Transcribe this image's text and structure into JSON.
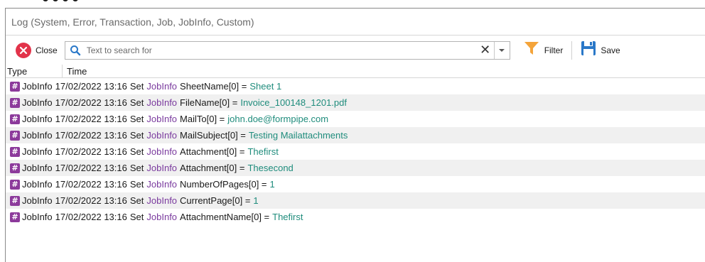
{
  "window": {
    "title": "Log (System, Error, Transaction, Job, JobInfo, Custom)"
  },
  "toolbar": {
    "close_label": "Close",
    "search_placeholder": "Text to search for",
    "search_value": "",
    "clear_glyph": "✕",
    "filter_label": "Filter",
    "save_label": "Save"
  },
  "icons": {
    "close": "close-icon",
    "search": "search-icon",
    "clear": "clear-icon",
    "dropdown": "chevron-down-icon",
    "filter": "funnel-icon",
    "save": "floppy-disk-icon",
    "row_type": "hash-icon"
  },
  "colors": {
    "close_red": "#e2334a",
    "jobinfo_purple": "#8c3a9b",
    "value_teal": "#1f8c7c",
    "filter_orange": "#f4a43a",
    "save_blue": "#2a78c8"
  },
  "grid": {
    "columns": [
      "Type",
      "Time"
    ],
    "rows": [
      {
        "type": "JobInfo",
        "time": "17/02/2022 13:16",
        "verb": "Set",
        "kind": "JobInfo",
        "name": "SheetName[0] =",
        "value": "Sheet 1"
      },
      {
        "type": "JobInfo",
        "time": "17/02/2022 13:16",
        "verb": "Set",
        "kind": "JobInfo",
        "name": "FileName[0] =",
        "value": "Invoice_100148_1201.pdf"
      },
      {
        "type": "JobInfo",
        "time": "17/02/2022 13:16",
        "verb": "Set",
        "kind": "JobInfo",
        "name": "MailTo[0] =",
        "value": "john.doe@formpipe.com"
      },
      {
        "type": "JobInfo",
        "time": "17/02/2022 13:16",
        "verb": "Set",
        "kind": "JobInfo",
        "name": "MailSubject[0] =",
        "value": "Testing Mailattachments"
      },
      {
        "type": "JobInfo",
        "time": "17/02/2022 13:16",
        "verb": "Set",
        "kind": "JobInfo",
        "name": "Attachment[0] =",
        "value": "Thefirst"
      },
      {
        "type": "JobInfo",
        "time": "17/02/2022 13:16",
        "verb": "Set",
        "kind": "JobInfo",
        "name": "Attachment[0] =",
        "value": "Thesecond"
      },
      {
        "type": "JobInfo",
        "time": "17/02/2022 13:16",
        "verb": "Set",
        "kind": "JobInfo",
        "name": "NumberOfPages[0] =",
        "value": "1"
      },
      {
        "type": "JobInfo",
        "time": "17/02/2022 13:16",
        "verb": "Set",
        "kind": "JobInfo",
        "name": "CurrentPage[0] =",
        "value": "1"
      },
      {
        "type": "JobInfo",
        "time": "17/02/2022 13:16",
        "verb": "Set",
        "kind": "JobInfo",
        "name": "AttachmentName[0] =",
        "value": "Thefirst"
      }
    ]
  }
}
